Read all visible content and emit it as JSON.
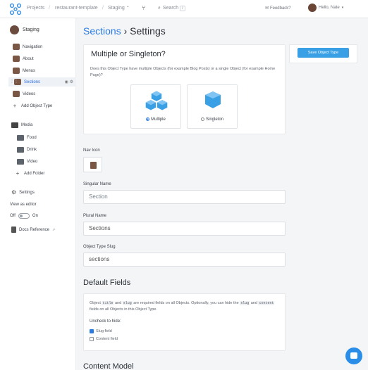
{
  "topbar": {
    "projects": "Projects",
    "bucket": "restaurant-template",
    "env": "Staging",
    "search": "Search",
    "search_key": "/",
    "feedback": "Feedback?",
    "greeting": "Hello, Nate"
  },
  "sidebar": {
    "project": "Staging",
    "object_types": [
      {
        "label": "Navigation"
      },
      {
        "label": "About"
      },
      {
        "label": "Menus"
      },
      {
        "label": "Sections"
      },
      {
        "label": "Videos"
      }
    ],
    "add_object_type": "Add Object Type",
    "media": "Media",
    "folders": [
      {
        "label": "Food"
      },
      {
        "label": "Drink"
      },
      {
        "label": "Video"
      }
    ],
    "add_folder": "Add Folder",
    "settings": "Settings",
    "view_as_editor": "View as editor",
    "off": "Off",
    "on": "On",
    "docs": "Docs Reference"
  },
  "header": {
    "object_type": "Sections",
    "separator": "›",
    "page": "Settings"
  },
  "save_button": "Save Object Type",
  "type_card": {
    "title": "Multiple or Singleton?",
    "description": "Does this Object Type have multiple Objects (for example Blog Posts) or a single Object (for example Home Page)?",
    "multiple": "Multiple",
    "singleton": "Singleton",
    "selected": "Multiple"
  },
  "fields": {
    "nav_icon_label": "Nav Icon",
    "singular_label": "Singular Name",
    "singular_value": "Section",
    "plural_label": "Plural Name",
    "plural_value": "Sections",
    "slug_label": "Object Type Slug",
    "slug_value": "sections"
  },
  "default_fields": {
    "title": "Default Fields",
    "text_1": "Object",
    "code_title": "title",
    "text_2": "and",
    "code_slug": "slug",
    "text_3": "are required fields on all Objects. Optionally, you can hide the",
    "code_slug2": "slug",
    "text_4": "and",
    "code_content": "content",
    "text_5": "fields on all Objects in this Object Type.",
    "uncheck_label": "Uncheck to hide:",
    "slug_field": "Slug field",
    "content_field": "Content field"
  },
  "content_model_title": "Content Model",
  "colors": {
    "accent": "#2a7ae2",
    "save_button": "#3aa0e6",
    "cube": "#3aa0e6"
  }
}
